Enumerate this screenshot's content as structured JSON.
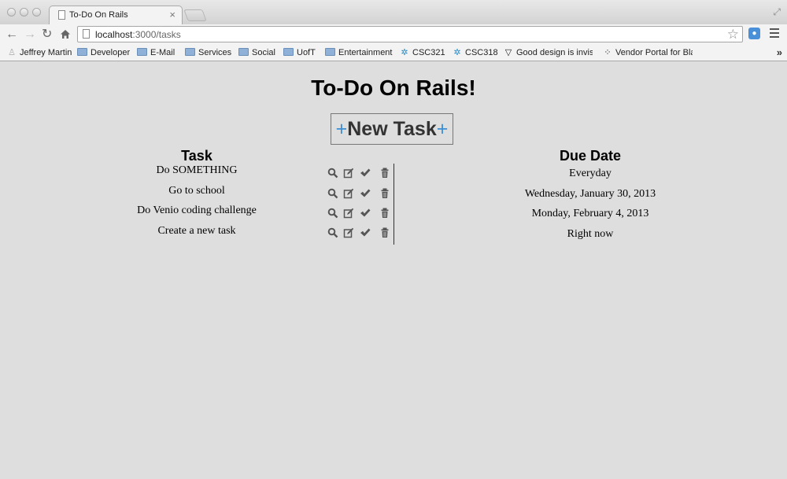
{
  "browser": {
    "tab_title": "To-Do On Rails",
    "tab_close": "×",
    "url_host": "localhost",
    "url_rest": ":3000/tasks",
    "bookmarks": [
      {
        "label": "Jeffrey Martin",
        "icon": "person-icon"
      },
      {
        "label": "Developer",
        "icon": "folder-icon"
      },
      {
        "label": "E-Mail",
        "icon": "folder-icon"
      },
      {
        "label": "Services",
        "icon": "folder-icon"
      },
      {
        "label": "Social",
        "icon": "folder-icon"
      },
      {
        "label": "UofT",
        "icon": "folder-icon"
      },
      {
        "label": "Entertainment",
        "icon": "folder-icon"
      },
      {
        "label": "CSC321",
        "icon": "snowflake-icon"
      },
      {
        "label": "CSC318",
        "icon": "snowflake-icon"
      },
      {
        "label": "Good design is invis",
        "icon": "v-logo-icon"
      },
      {
        "label": "Vendor Portal for Bla",
        "icon": "blackberry-icon"
      }
    ],
    "bookmarks_more": "»"
  },
  "page": {
    "title": "To-Do On Rails!",
    "new_task_plus": "+",
    "new_task_label": "New Task",
    "task_header": "Task",
    "due_header": "Due Date",
    "tasks": [
      {
        "name": "Do SOMETHING",
        "due": "Everyday"
      },
      {
        "name": "Go to school",
        "due": "Wednesday, January 30, 2013"
      },
      {
        "name": "Do Venio coding challenge",
        "due": "Monday, February 4, 2013"
      },
      {
        "name": "Create a new task",
        "due": "Right now"
      }
    ],
    "action_icons": [
      "search-icon",
      "edit-icon",
      "check-icon",
      "trash-icon"
    ]
  },
  "colors": {
    "page_background": "#dedede",
    "plus_accent": "#3b8fd6"
  }
}
